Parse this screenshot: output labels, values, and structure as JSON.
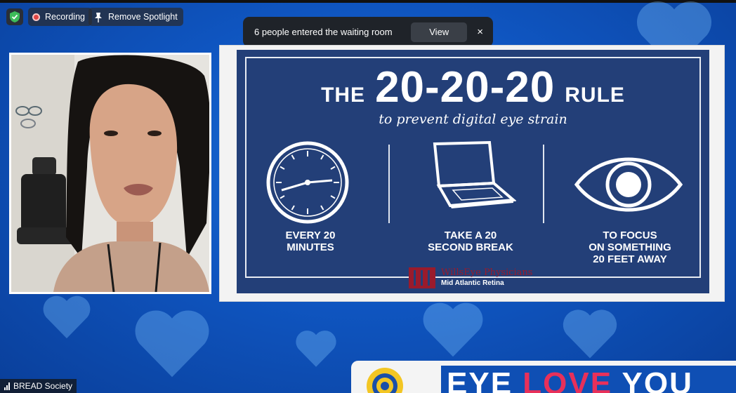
{
  "toolbar": {
    "recording_label": "Recording",
    "remove_spotlight_label": "Remove Spotlight"
  },
  "notification": {
    "message": "6 people entered the waiting room",
    "view_label": "View",
    "close_glyph": "×"
  },
  "slide": {
    "title_pre": "THE",
    "title_rule": "20-20-20",
    "title_post": "RULE",
    "subtitle": "to prevent digital eye strain",
    "captions": [
      "EVERY 20\nMINUTES",
      "TAKE A 20\nSECOND BREAK",
      "TO FOCUS\nON SOMETHING\n20 FEET AWAY"
    ],
    "icons": [
      "clock-icon",
      "laptop-icon",
      "eye-icon"
    ],
    "logo_name": "WillsEye Physicians",
    "logo_sub": "Mid Atlantic Retina"
  },
  "participant": {
    "name": "BREAD Society"
  },
  "banner": {
    "word1": "EYE ",
    "word2_start": "L",
    "word2_heart": "O",
    "word2_end": "VE",
    "word3": " YOU"
  },
  "colors": {
    "slide_bg": "#233f78",
    "brand_red": "#9a1b2c",
    "love_pink": "#e8305a",
    "record_red": "#e04545",
    "shield_green": "#3dbb5a"
  }
}
